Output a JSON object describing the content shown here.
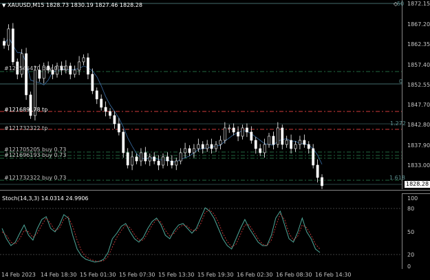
{
  "header": {
    "menu_arrow_glyph": "▼",
    "symbol_tf": "XAUUSD,M15",
    "ohlc": "1828.73 1830.19 1827.46 1828.28",
    "corner_icon": "diamond-icon"
  },
  "stoch_header": "Stoch(14,3,3) 14.0314 24.9906",
  "price_axis": [
    "1872.15",
    "1867.20",
    "1862.35",
    "1857.40",
    "1852.55",
    "1847.70",
    "1842.80",
    "1837.90",
    "1833.00"
  ],
  "current_price": "1828.28",
  "stoch_axis": [
    "100",
    "80",
    "50",
    "20",
    "0"
  ],
  "time_axis": [
    "14 Feb 2023",
    "14 Feb 18:30",
    "15 Feb 01:30",
    "15 Feb 07:30",
    "15 Feb 13:30",
    "15 Feb 19:30",
    "16 Feb 02:30",
    "16 Feb 08:30",
    "16 Feb 14:30"
  ],
  "fib_labels": {
    "top": "50",
    "mid": "0",
    "upper": "1.272",
    "lower": "1.618"
  },
  "orders": [
    {
      "text": "#121545470 buy 0.73"
    },
    {
      "text": "#121689178 tp"
    },
    {
      "text": "#121732322 tp"
    },
    {
      "text": "#121705205 buy 0.73"
    },
    {
      "text": "#121696193 buy 0.73"
    },
    {
      "text": "#121732322 buy 0.73"
    }
  ],
  "colors": {
    "bg": "#000000",
    "candle": "#ffffff",
    "wick": "#ffffff",
    "ma": "#3a6ea5",
    "order_line": "#2e8b57",
    "tp_line": "#d23c3c",
    "fib": "#5a8f8f",
    "stoch_main": "#4fa89a",
    "stoch_signal": "#d23c3c",
    "grid": "#555555"
  },
  "chart_data": {
    "type": "candlestick",
    "ylim": [
      1828.0,
      1872.15
    ],
    "series": [
      {
        "values": [
          1862,
          1866,
          1858,
          1855,
          1860,
          1850,
          1845,
          1856,
          1854,
          1857,
          1856,
          1855,
          1857,
          1856,
          1857,
          1855,
          1856,
          1858,
          1859,
          1855,
          1851,
          1849,
          1847,
          1846,
          1845,
          1843,
          1841,
          1836,
          1833,
          1835,
          1834,
          1836,
          1834,
          1835,
          1834,
          1833,
          1835,
          1834,
          1833,
          1834,
          1836,
          1837,
          1836,
          1837,
          1838,
          1837,
          1838,
          1837,
          1838,
          1839,
          1842,
          1842,
          1841,
          1840,
          1842,
          1841,
          1839,
          1837,
          1836,
          1838,
          1840,
          1838,
          1842,
          1838,
          1839,
          1837,
          1838,
          1839,
          1838,
          1837,
          1833,
          1830,
          1828
        ]
      }
    ],
    "stoch_main": [
      55,
      40,
      30,
      35,
      48,
      60,
      45,
      38,
      55,
      68,
      72,
      55,
      50,
      60,
      75,
      70,
      45,
      25,
      15,
      10,
      8,
      6,
      7,
      10,
      20,
      40,
      48,
      58,
      62,
      50,
      40,
      35,
      42,
      55,
      65,
      70,
      60,
      45,
      40,
      52,
      60,
      62,
      55,
      48,
      55,
      70,
      85,
      80,
      70,
      55,
      40,
      30,
      25,
      40,
      55,
      68,
      55,
      45,
      35,
      30,
      30,
      45,
      70,
      80,
      60,
      40,
      35,
      50,
      70,
      50,
      40,
      25,
      20
    ],
    "stoch_signal": [
      50,
      45,
      35,
      32,
      40,
      52,
      50,
      42,
      48,
      60,
      70,
      62,
      52,
      55,
      68,
      72,
      58,
      38,
      22,
      14,
      10,
      8,
      7,
      8,
      14,
      28,
      42,
      52,
      60,
      56,
      46,
      38,
      38,
      48,
      60,
      68,
      64,
      52,
      44,
      48,
      56,
      60,
      58,
      52,
      52,
      62,
      78,
      82,
      76,
      64,
      48,
      36,
      28,
      32,
      46,
      60,
      60,
      50,
      40,
      32,
      30,
      38,
      58,
      76,
      68,
      48,
      38,
      44,
      60,
      56,
      45,
      32,
      25
    ]
  }
}
